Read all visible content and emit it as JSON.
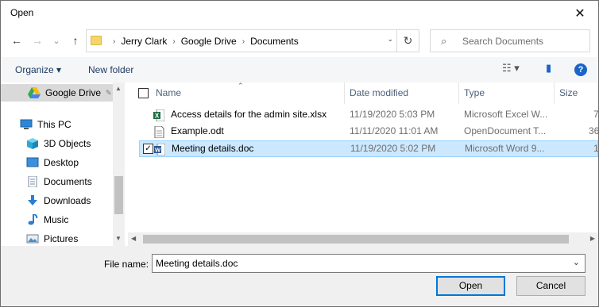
{
  "window": {
    "title": "Open",
    "close_glyph": "✕"
  },
  "nav": {
    "back_glyph": "←",
    "forward_glyph": "→",
    "recent_glyph": "⌄",
    "up_glyph": "↑",
    "breadcrumbs": [
      "Jerry Clark",
      "Google Drive",
      "Documents"
    ],
    "crumb_separator": "›",
    "refresh_glyph": "↻",
    "search_placeholder": "Search Documents"
  },
  "toolbar": {
    "organize": "Organize ▾",
    "new_folder": "New folder",
    "view_glyph": "☷ ▾",
    "pane_glyph": "▮",
    "help": "?"
  },
  "sidebar": {
    "items": [
      {
        "label": "Google Drive",
        "pin": "📌",
        "icon": "google-drive-icon",
        "selected": true
      },
      {
        "label": "This PC",
        "icon": "computer-icon"
      },
      {
        "label": "3D Objects",
        "icon": "cube-icon"
      },
      {
        "label": "Desktop",
        "icon": "desktop-icon"
      },
      {
        "label": "Documents",
        "icon": "documents-icon"
      },
      {
        "label": "Downloads",
        "icon": "download-icon"
      },
      {
        "label": "Music",
        "icon": "music-icon"
      },
      {
        "label": "Pictures",
        "icon": "pictures-icon"
      }
    ]
  },
  "columns": {
    "name": "Name",
    "date": "Date modified",
    "type": "Type",
    "size": "Size"
  },
  "files": [
    {
      "name": "Access details for the admin site.xlsx",
      "date": "11/19/2020 5:03 PM",
      "type": "Microsoft Excel W...",
      "size": "7",
      "icon": "excel-icon",
      "selected": false
    },
    {
      "name": "Example.odt",
      "date": "11/11/2020 11:01 AM",
      "type": "OpenDocument T...",
      "size": "36",
      "icon": "document-icon",
      "selected": false
    },
    {
      "name": "Meeting details.doc",
      "date": "11/19/2020 5:02 PM",
      "type": "Microsoft Word 9...",
      "size": "1",
      "icon": "word-icon",
      "selected": true,
      "checked": "✓"
    }
  ],
  "bottom": {
    "file_name_label": "File name:",
    "file_name_value": "Meeting details.doc",
    "open": "Open",
    "cancel": "Cancel"
  },
  "colors": {
    "selection": "#cce8ff",
    "accent": "#0078d7"
  }
}
